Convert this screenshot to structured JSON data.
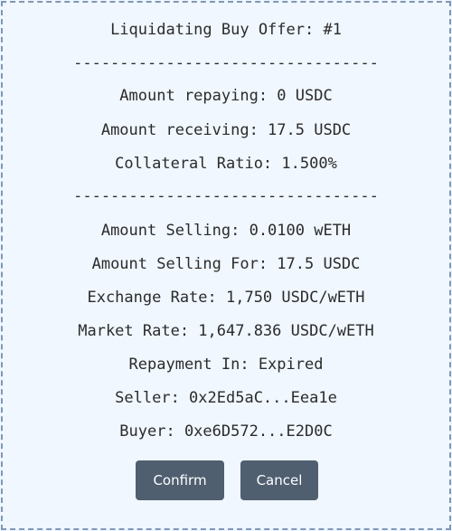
{
  "dialog": {
    "title": "Liquidating Buy Offer: #1",
    "divider": "---------------------------------",
    "amount_repaying": "Amount repaying: 0 USDC",
    "amount_receiving": "Amount receiving: 17.5 USDC",
    "collateral_ratio": "Collateral Ratio: 1.500%",
    "amount_selling": "Amount Selling: 0.0100 wETH",
    "amount_selling_for": "Amount Selling For: 17.5 USDC",
    "exchange_rate": "Exchange Rate: 1,750 USDC/wETH",
    "market_rate": "Market Rate: 1,647.836 USDC/wETH",
    "repayment_in": "Repayment In: Expired",
    "seller": "Seller: 0x2Ed5aC...Eea1e",
    "buyer": "Buyer: 0xe6D572...E2D0C",
    "confirm_label": "Confirm",
    "cancel_label": "Cancel"
  }
}
